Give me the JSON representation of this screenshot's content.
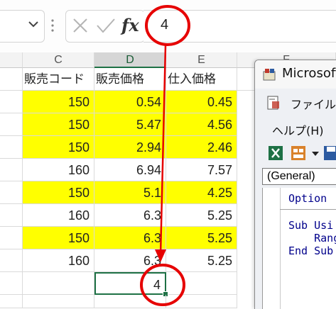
{
  "formula_bar": {
    "name_box_dropdown_icon": "chevron-down-icon",
    "cancel_icon": "x-icon",
    "enter_icon": "check-icon",
    "fx_label": "fx",
    "value": "4"
  },
  "sheet": {
    "columns": [
      "C",
      "D",
      "E",
      "F"
    ],
    "selected_column": "D",
    "header_row": [
      "販売コード",
      "販売価格",
      "仕入価格"
    ],
    "rows": [
      {
        "code": "150",
        "price": "0.54",
        "cost": "0.45",
        "highlight": true
      },
      {
        "code": "150",
        "price": "5.47",
        "cost": "4.56",
        "highlight": true
      },
      {
        "code": "150",
        "price": "2.94",
        "cost": "2.46",
        "highlight": true
      },
      {
        "code": "160",
        "price": "6.94",
        "cost": "7.57",
        "highlight": false
      },
      {
        "code": "150",
        "price": "5.1",
        "cost": "4.25",
        "highlight": true
      },
      {
        "code": "160",
        "price": "6.3",
        "cost": "5.25",
        "highlight": false
      },
      {
        "code": "150",
        "price": "6.3",
        "cost": "5.25",
        "highlight": true
      },
      {
        "code": "160",
        "price": "6.3",
        "cost": "5.25",
        "highlight": false
      }
    ],
    "result_cell_value": "4",
    "highlight_color": "#ffff00",
    "selection_color": "#1e7145"
  },
  "vbe": {
    "title": "Microsoft",
    "menu_file": "ファイル(F",
    "menu_help": "ヘルプ(H)",
    "object_combo": "(General)",
    "code_lines": [
      "Option",
      "Sub Usi",
      "    Rang",
      "End Sub"
    ]
  },
  "annotation": {
    "color": "#e60000"
  }
}
